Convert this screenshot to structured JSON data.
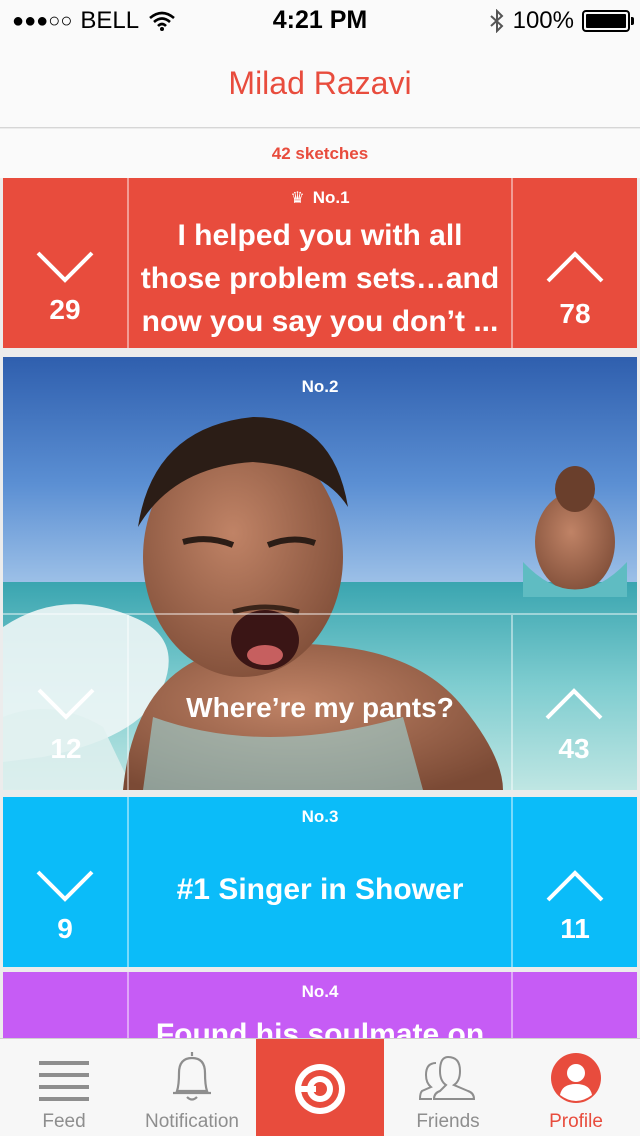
{
  "status_bar": {
    "signal_dots": "●●●○○",
    "carrier": "BELL",
    "time": "4:21 PM",
    "battery": "100%"
  },
  "header": {
    "title": "Milad Razavi"
  },
  "profile": {
    "sketch_count": "42 sketches"
  },
  "sketches": [
    {
      "rank": "No.1",
      "crown": true,
      "caption": "I helped you with all those problem sets…and now you say you don’t ...",
      "downvotes": "29",
      "upvotes": "78",
      "color": "#e84c3d"
    },
    {
      "rank": "No.2",
      "caption": "Where’re my pants?",
      "downvotes": "12",
      "upvotes": "43",
      "image": "photo-of-man-in-ocean"
    },
    {
      "rank": "No.3",
      "caption": "#1 Singer in Shower",
      "downvotes": "9",
      "upvotes": "11",
      "color": "#0bbcf9"
    },
    {
      "rank": "No.4",
      "caption": "Found his soulmate on",
      "color": "#c65cf5"
    }
  ],
  "tabs": [
    {
      "label": "Feed",
      "icon": "feed-icon"
    },
    {
      "label": "Notification",
      "icon": "bell-icon"
    },
    {
      "label": "",
      "icon": "camera-logo-icon"
    },
    {
      "label": "Friends",
      "icon": "friends-icon"
    },
    {
      "label": "Profile",
      "icon": "profile-icon",
      "active": true
    }
  ],
  "colors": {
    "accent": "#e84c3d",
    "blue_card": "#0bbcf9",
    "purple_card": "#c65cf5"
  }
}
